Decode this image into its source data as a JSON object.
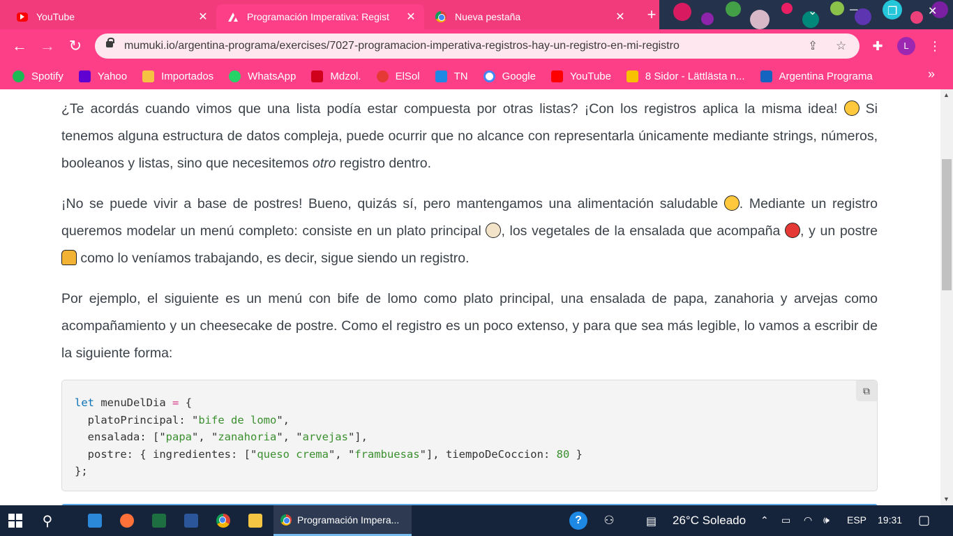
{
  "browser": {
    "tabs": [
      {
        "title": "YouTube",
        "icon": "youtube-icon"
      },
      {
        "title": "Programación Imperativa: Regist",
        "icon": "mumuki-icon",
        "active": true
      },
      {
        "title": "Nueva pestaña",
        "icon": "chrome-icon"
      }
    ],
    "new_tab_label": "+",
    "url": "mumuki.io/argentina-programa/exercises/7027-programacion-imperativa-registros-hay-un-registro-en-mi-registro",
    "profile_initial": "L",
    "bookmarks": [
      {
        "label": "Spotify",
        "icon": "spotify-icon",
        "color": "#1db954"
      },
      {
        "label": "Yahoo",
        "icon": "yahoo-mail-icon",
        "color": "#6001d2"
      },
      {
        "label": "Importados",
        "icon": "folder-icon",
        "color": "#f5c242"
      },
      {
        "label": "WhatsApp",
        "icon": "whatsapp-icon",
        "color": "#25d366"
      },
      {
        "label": "Mdzol.",
        "icon": "mdzol-icon",
        "color": "#d0021b"
      },
      {
        "label": "ElSol",
        "icon": "elsol-icon",
        "color": "#e53935"
      },
      {
        "label": "TN",
        "icon": "tn-icon",
        "color": "#1e88e5"
      },
      {
        "label": "Google",
        "icon": "google-icon",
        "color": "#ffffff"
      },
      {
        "label": "YouTube",
        "icon": "youtube-icon",
        "color": "#ff0000"
      },
      {
        "label": "8 Sidor - Lättlästa n...",
        "icon": "8sidor-icon",
        "color": "#f9c200"
      },
      {
        "label": "Argentina Programa",
        "icon": "mumuki-icon",
        "color": "#1565c0"
      }
    ],
    "more_bookmarks": "»"
  },
  "content": {
    "p1_a": "¿Te acordás cuando vimos que una lista podía estar compuesta por otras listas? ¡Con los registros aplica la misma idea! ",
    "p1_b": " Si tenemos alguna estructura de datos compleja, puede ocurrir que no alcance con representarla únicamente mediante strings, números, booleanos y listas, sino que necesitemos ",
    "p1_em": "otro",
    "p1_c": " registro dentro.",
    "p2_a": "¡No se puede vivir a base de postres! Bueno, quizás sí, pero mantengamos una alimentación saludable ",
    "p2_b": ". Mediante un registro queremos modelar un menú completo: consiste en un plato principal ",
    "p2_c": ", los vegetales de la ensalada que acompaña ",
    "p2_d": ", y un postre ",
    "p2_e": " como lo veníamos trabajando, es decir, sigue siendo un registro.",
    "p3": "Por ejemplo, el siguiente es un menú con bife de lomo como plato principal, una ensalada de papa, zanahoria y arvejas como acompañamiento y un cheesecake de postre. Como el registro es un poco extenso, y para que sea más legible, lo vamos a escribir de la siguiente forma:",
    "emojis": [
      "astonished-emoji-icon",
      "tongue-emoji-icon",
      "plate-emoji-icon",
      "tomato-emoji-icon",
      "flan-emoji-icon"
    ],
    "code": {
      "keyword": "let",
      "var": "menuDelDia",
      "assign": "=",
      "line1_open": "{",
      "k1": "platoPrincipal",
      "v1": "bife de lomo",
      "k2": "ensalada",
      "v2": [
        "papa",
        "zanahoria",
        "arvejas"
      ],
      "k3": "postre",
      "k3_inner": "ingredientes",
      "v3": [
        "queso crema",
        "frambuesas"
      ],
      "k4": "tiempoDeCoccion",
      "v4": "80",
      "close": "};"
    }
  },
  "taskbar": {
    "active_window": "Programación Impera...",
    "weather": "26°C  Soleado",
    "language": "ESP",
    "time": "19:31"
  }
}
